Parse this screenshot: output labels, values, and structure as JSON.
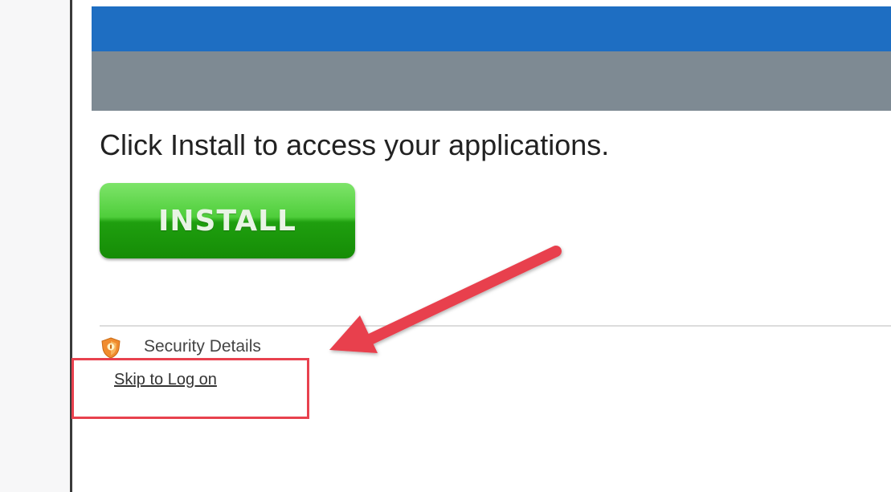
{
  "message": {
    "text": "Click Install to access your applications."
  },
  "install_button": {
    "label": "INSTALL"
  },
  "security": {
    "label": "Security Details",
    "icon": "shield-icon"
  },
  "skip_link": {
    "label": "Skip to Log on"
  },
  "colors": {
    "header_blue": "#1e6ec2",
    "header_gray": "#7e8a93",
    "install_green": "#2fb31e",
    "annotation_red": "#e8414e"
  }
}
